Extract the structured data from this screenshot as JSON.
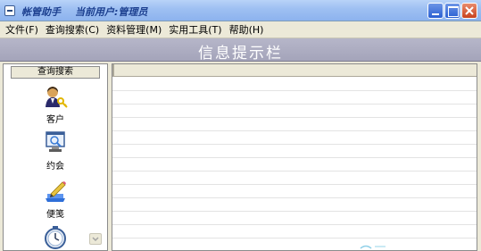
{
  "window": {
    "app_title": "帐管助手",
    "user_label": "当前用户:",
    "user_name": "管理员"
  },
  "menu": [
    {
      "label": "文件(F)"
    },
    {
      "label": "查询搜索(C)"
    },
    {
      "label": "资料管理(M)"
    },
    {
      "label": "实用工具(T)"
    },
    {
      "label": "帮助(H)"
    }
  ],
  "banner": {
    "title": "信息提示栏"
  },
  "leftnav": {
    "header": "查询搜索",
    "items": [
      {
        "label": "客户",
        "icon": "customer-icon"
      },
      {
        "label": "约会",
        "icon": "appointment-icon"
      },
      {
        "label": "便笺",
        "icon": "notepad-icon"
      },
      {
        "label": "",
        "icon": "clock-icon"
      }
    ]
  },
  "colors": {
    "titlebar": "#9dbff2",
    "banner": "#a4a4ba",
    "close_button": "#c8421f"
  }
}
